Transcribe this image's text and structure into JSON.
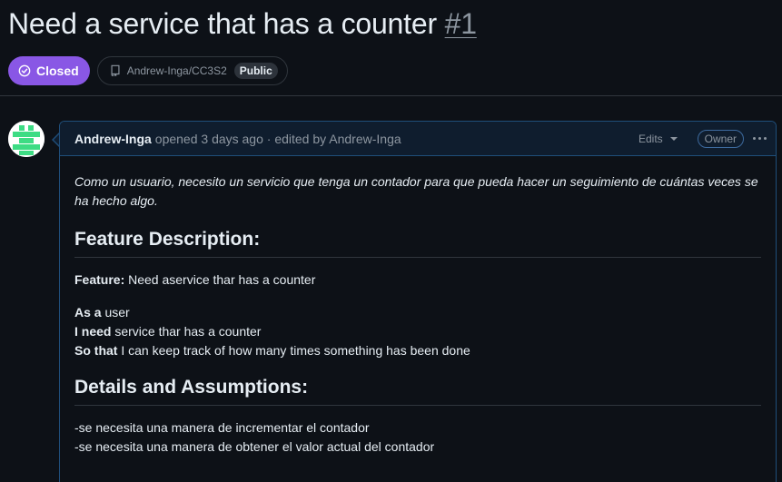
{
  "issue": {
    "title": "Need a service that has a counter",
    "number": "#1",
    "state": "Closed",
    "repo": "Andrew-Inga/CC3S2",
    "visibility": "Public"
  },
  "comment": {
    "author": "Andrew-Inga",
    "meta": "opened 3 days ago · edited by Andrew-Inga",
    "edits_label": "Edits",
    "role_badge": "Owner",
    "intro": "Como un usuario, necesito un servicio que tenga un contador para que pueda hacer un seguimiento de cuántas veces se ha hecho algo.",
    "feature_heading": "Feature Description:",
    "feature_label": "Feature:",
    "feature_text": " Need aservice thar has a counter",
    "as_a_label": "As a",
    "as_a_text": " user",
    "i_need_label": "I need",
    "i_need_text": " service thar has a counter",
    "so_that_label": "So that",
    "so_that_text": " I can keep track of how many times something has been done",
    "details_heading": "Details and Assumptions:",
    "details": [
      "-se necesita una manera de incrementar el contador",
      "-se necesita una manera de obtener el valor actual del contador"
    ]
  },
  "colors": {
    "closed_badge": "#8957e5",
    "avatar_green": "#3ddc84",
    "comment_border": "#1f4e7a"
  },
  "icons": {
    "state": "check-circle-icon",
    "repo": "repo-icon",
    "more": "kebab-horizontal-icon",
    "edits_caret": "triangle-down-icon"
  }
}
